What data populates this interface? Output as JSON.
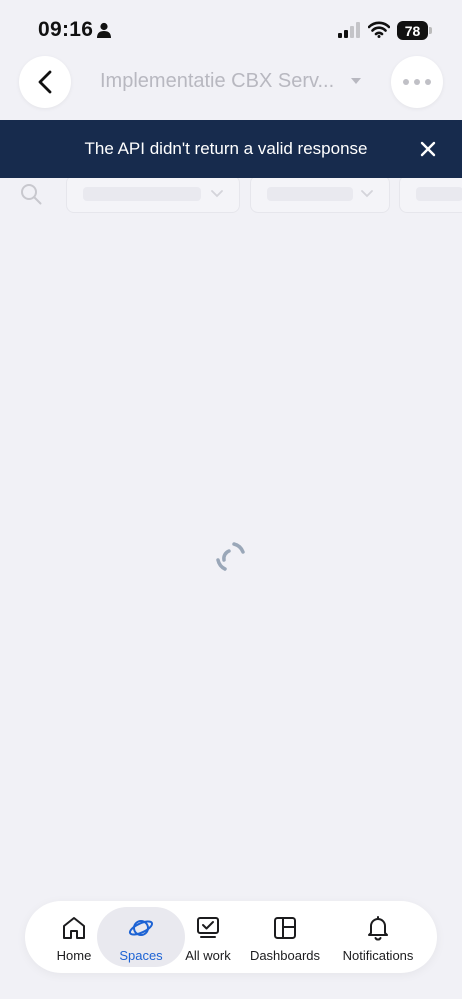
{
  "status_bar": {
    "time": "09:16",
    "battery": "78"
  },
  "header": {
    "title": "Implementatie CBX Serv..."
  },
  "banner": {
    "message": "The API didn't return a valid response"
  },
  "nav": {
    "items": [
      {
        "label": "Home"
      },
      {
        "label": "Spaces"
      },
      {
        "label": "All work"
      },
      {
        "label": "Dashboards"
      },
      {
        "label": "Notifications"
      }
    ]
  },
  "colors": {
    "banner_bg": "#172b4d",
    "accent": "#1d63d4",
    "background": "#f1f1f6"
  }
}
